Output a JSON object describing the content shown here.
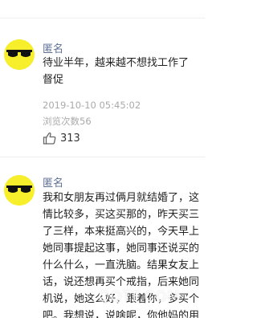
{
  "top_fragment": "",
  "comments": [
    {
      "username": "匿名",
      "lines": [
        "待业半年，越来越不想找工作了",
        "督促"
      ],
      "timestamp": "2019-10-10 05:45:02",
      "views": "浏览次数56",
      "likes": "313",
      "avatar_icon": "sunglasses-emoji-icon"
    },
    {
      "username": "匿名",
      "lines": [
        "我和女朋友再过俩月就结婚了，这",
        "情比较多，买这买那的，昨天买三",
        "了三样，本来挺高兴的，今天早上",
        "她同事提起这事，她同事还说买的",
        "什么什么，一直洗脑。结果女友上",
        "话，说还想再买个戒指，后来她同",
        "机说，她这么好，跟着你，多买个",
        "吧。我想说，说啥呢，你他妈的用"
      ],
      "avatar_icon": "sunglasses-emoji-icon"
    }
  ],
  "watermark": "QQTF.COM",
  "colors": {
    "username": "#5c6f93",
    "meta": "#aaaaaa",
    "avatar_bg": "#f7ef2b"
  },
  "icons": {
    "like": "thumbs-up-icon"
  }
}
